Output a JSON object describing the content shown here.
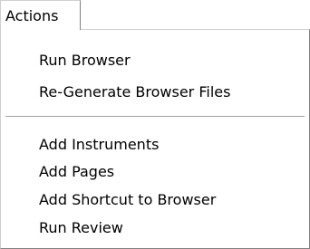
{
  "menu": {
    "title": "Actions",
    "items": [
      {
        "label": "Run Browser"
      },
      {
        "label": "Re-Generate Browser Files"
      },
      {
        "label": "Add Instruments"
      },
      {
        "label": "Add Pages"
      },
      {
        "label": "Add Shortcut to Browser"
      },
      {
        "label": "Run Review"
      }
    ]
  }
}
